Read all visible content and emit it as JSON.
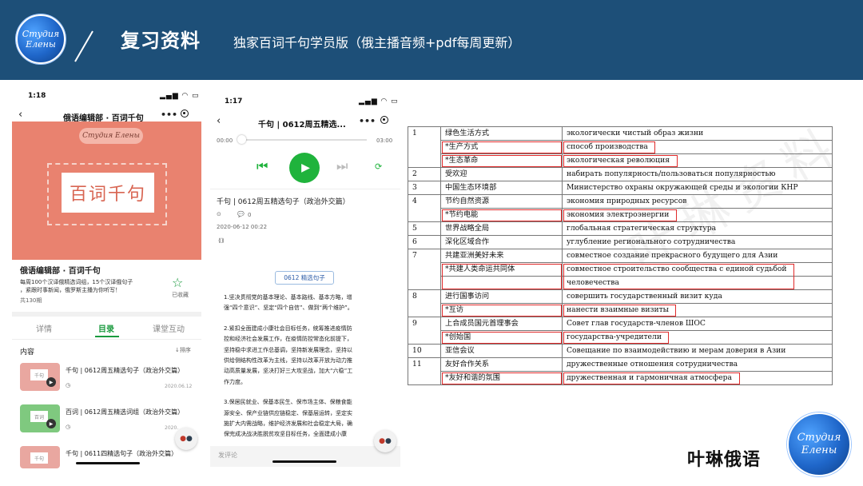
{
  "header": {
    "logo_line1": "Cmyдия",
    "logo_line2": "Eлены",
    "title": "复习资料",
    "subtitle": "独家百词千句学员版（俄主播音频+pdf每周更新）"
  },
  "phone1": {
    "time": "1:18",
    "nav_title": "俄语编辑部 · 百词千句",
    "cover_pill": "Студия Елены",
    "cover_text": "百词千句",
    "album_title": "俄语编辑部 · 百词千句",
    "album_desc_line1": "每周100个汉译俄精选词组，15个汉译俄句子",
    "album_desc_line2": "，紧跟时事新闻，俄罗斯主播为你听写！",
    "album_count": "共130期",
    "fav_label": "已收藏",
    "tabs": [
      "详情",
      "目录",
      "课堂互动"
    ],
    "section_label": "内容",
    "sort_label": "↓排序",
    "items": [
      {
        "title": "千句 | 0612周五精选句子（政治外交篇）",
        "date": "2020.06.12",
        "thumb": "千句"
      },
      {
        "title": "百词 | 0612周五精选词组（政治外交篇）",
        "date": "2020.",
        "thumb": "百词"
      },
      {
        "title": "千句 | 0611四精选句子（政治外交篇）",
        "date": "",
        "thumb": "千句"
      }
    ]
  },
  "phone2": {
    "time": "1:17",
    "nav_title": "千句 | 0612周五精选...",
    "time_start": "00:00",
    "time_end": "03:00",
    "article_title": "千句 | 0612周五精选句子（政治外交篇）",
    "comment_count": "0",
    "article_date": "2020-06-12 00:22",
    "tag": "0612 精选句子",
    "paragraphs": [
      [
        "1.坚决贯彻党的基本理论、基本路线、基本方略，增",
        "强“四个意识”、坚定“四个自信”、做到“两个维护”。"
      ],
      [
        "2.紧扣全面建成小康社会目标任务，统筹推进疫情防",
        "控和经济社会发展工作，在疫情防控常态化前提下，",
        "坚持稳中求进工作总基调，坚持新发展理念，坚持以",
        "供给侧结构性改革为主线，坚持以改革开放为动力推",
        "动高质量发展，坚决打好三大攻坚战，加大“六稳”工",
        "作力度。"
      ],
      [
        "3.保居民就业、保基本民生、保市场主体、保粮食能",
        "源安全、保产业链供应链稳定、保基层运转，坚定实",
        "施扩大内需战略，维护经济发展和社会稳定大局，确",
        "保完成决战决胜脱贫攻坚目标任务，全面建成小康"
      ]
    ],
    "comment_placeholder": "发评论"
  },
  "table": {
    "rows": [
      {
        "n": "1",
        "lines": [
          [
            "绿色生活方式",
            "экологически чистый образ жизни"
          ],
          [
            "*生产方式",
            "способ производства"
          ],
          [
            "*生态革命",
            "экологическая революция"
          ]
        ]
      },
      {
        "n": "2",
        "lines": [
          [
            "受欢迎",
            "набирать популярность/пользоваться популярностью"
          ]
        ]
      },
      {
        "n": "3",
        "lines": [
          [
            "中国生态环境部",
            "Министерство охраны окружающей среды и экологии КНР"
          ]
        ]
      },
      {
        "n": "4",
        "lines": [
          [
            "节约自然资源",
            "экономия природных ресурсов"
          ],
          [
            "*节约电能",
            "экономия электроэнергии"
          ]
        ]
      },
      {
        "n": "5",
        "lines": [
          [
            "世界战略全局",
            "глобальная стратегическая структура"
          ]
        ]
      },
      {
        "n": "6",
        "lines": [
          [
            "深化区域合作",
            "углубление регионального сотрудничества"
          ]
        ]
      },
      {
        "n": "7",
        "lines": [
          [
            "共建亚洲美好未来",
            "совместное создание прекрасного будущего для Азии"
          ],
          [
            "*共建人类命运共同体",
            "совместное строительство сообщества с единой судьбой"
          ],
          [
            "",
            "человечества"
          ]
        ]
      },
      {
        "n": "8",
        "lines": [
          [
            "进行国事访问",
            "совершить государственный визит куда"
          ],
          [
            "*互访",
            "нанести взаимные визиты"
          ]
        ]
      },
      {
        "n": "9",
        "lines": [
          [
            "上合成员国元首理事会",
            "Совет глав государств-членов ШОС"
          ],
          [
            "*创始国",
            "государства-учредители"
          ]
        ]
      },
      {
        "n": "10",
        "lines": [
          [
            "亚信会议",
            "Совещание по взаимодействию и мерам доверия в Азии"
          ]
        ]
      },
      {
        "n": "11",
        "lines": [
          [
            "友好合作关系",
            "дружественные отношения сотрудничества"
          ],
          [
            "*友好和谐的氛围",
            "дружественная и гармоничная атмосфера"
          ]
        ]
      }
    ]
  },
  "watermark": "叶琳资料",
  "brand": "叶琳俄语"
}
